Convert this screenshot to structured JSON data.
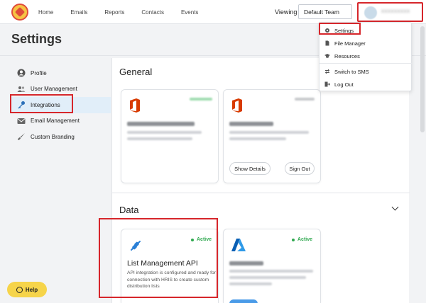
{
  "nav": {
    "links": [
      "Home",
      "Emails",
      "Reports",
      "Contacts",
      "Events"
    ],
    "viewing_label": "Viewing",
    "team_value": "Default Team"
  },
  "page": {
    "title": "Settings"
  },
  "sidebar": {
    "items": [
      {
        "label": "Profile",
        "icon": "user-circle-icon"
      },
      {
        "label": "User Management",
        "icon": "users-icon"
      },
      {
        "label": "Integrations",
        "icon": "key-icon"
      },
      {
        "label": "Email Management",
        "icon": "envelope-icon"
      },
      {
        "label": "Custom Branding",
        "icon": "brush-icon"
      }
    ],
    "active_index": 2
  },
  "main": {
    "general_heading": "General",
    "data_heading": "Data",
    "general_cards": {
      "show_details": "Show Details",
      "sign_out": "Sign Out"
    },
    "data_cards": {
      "list_api": {
        "status": "Active",
        "title": "List Management API",
        "description": "API integration is configured and ready for connection with HRIS to create custom distribution lists"
      },
      "azure": {
        "status": "Active"
      }
    }
  },
  "dropdown": {
    "items": [
      {
        "label": "Settings",
        "icon": "gear-icon"
      },
      {
        "label": "File Manager",
        "icon": "file-icon"
      },
      {
        "label": "Resources",
        "icon": "graduation-cap-icon"
      },
      {
        "label": "Switch to SMS",
        "icon": "switch-icon"
      },
      {
        "label": "Log Out",
        "icon": "logout-icon"
      }
    ]
  },
  "help": {
    "label": "Help"
  },
  "colors": {
    "accent_red": "#d6262b",
    "active_green": "#2fa84f",
    "sidebar_active": "#e1eef9",
    "help_yellow": "#f6d44a"
  }
}
